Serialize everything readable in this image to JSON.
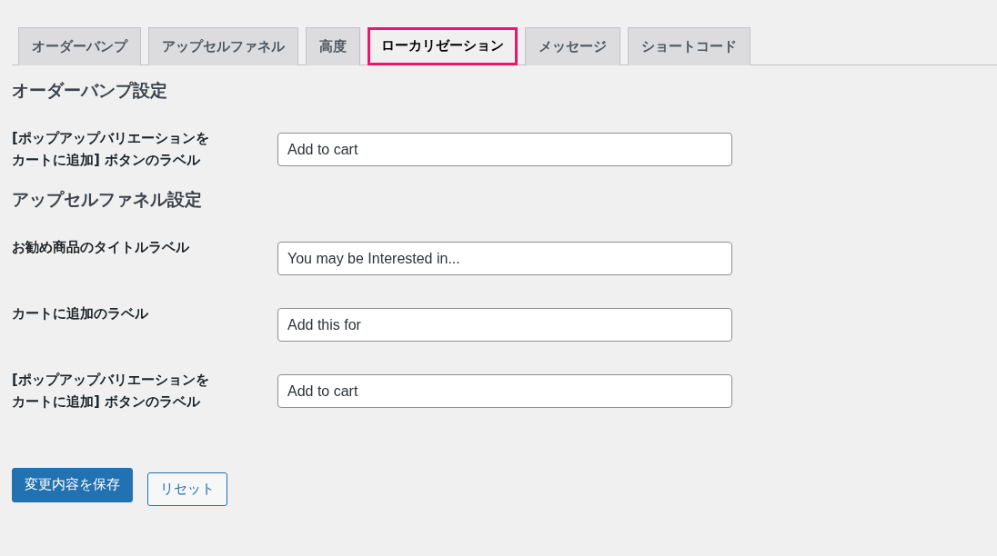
{
  "tabs": [
    {
      "label": "オーダーバンプ",
      "selected": false
    },
    {
      "label": "アップセルファネル",
      "selected": false
    },
    {
      "label": "高度",
      "selected": false
    },
    {
      "label": "ローカリゼーション",
      "selected": true
    },
    {
      "label": "メッセージ",
      "selected": false
    },
    {
      "label": "ショートコード",
      "selected": false
    }
  ],
  "sections": [
    {
      "heading": "オーダーバンプ設定",
      "fields": [
        {
          "label": "[ポップアップバリエーションをカートに追加] ボタンのラベル",
          "value": "Add to cart"
        }
      ]
    },
    {
      "heading": "アップセルファネル設定",
      "fields": [
        {
          "label": "お勧め商品のタイトルラベル",
          "value": "You may be Interested in..."
        },
        {
          "label": "カートに追加のラベル",
          "value": "Add this for"
        },
        {
          "label": "[ポップアップバリエーションをカートに追加] ボタンのラベル",
          "value": "Add to cart"
        }
      ]
    }
  ],
  "buttons": {
    "save": "変更内容を保存",
    "reset": "リセット"
  }
}
